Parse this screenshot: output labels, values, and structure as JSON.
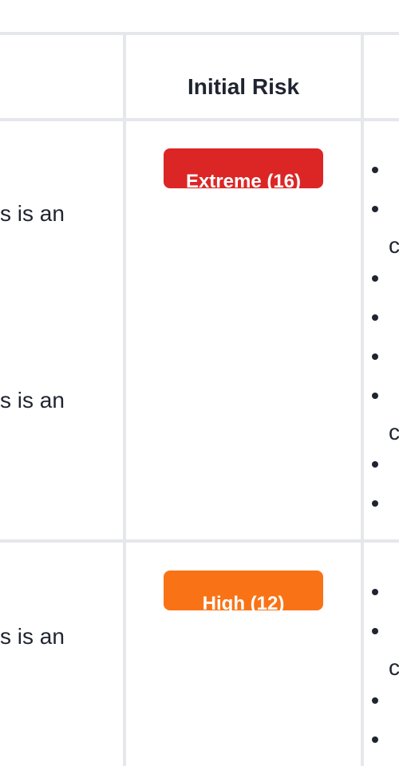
{
  "header": {
    "initial_risk_label": "Initial Risk"
  },
  "rows": [
    {
      "risk_badge": "Extreme (16)",
      "risk_color": "#dc2626",
      "descriptions": [
        "s is an",
        "s is an"
      ]
    },
    {
      "risk_badge": "High (12)",
      "risk_color": "#f97316",
      "descriptions": [
        "s is an"
      ]
    }
  ],
  "controls_partial_letter": "c",
  "colors": {
    "grid": "#e6e7eb",
    "text": "#1f2430",
    "extreme": "#dc2626",
    "high": "#f97316"
  }
}
